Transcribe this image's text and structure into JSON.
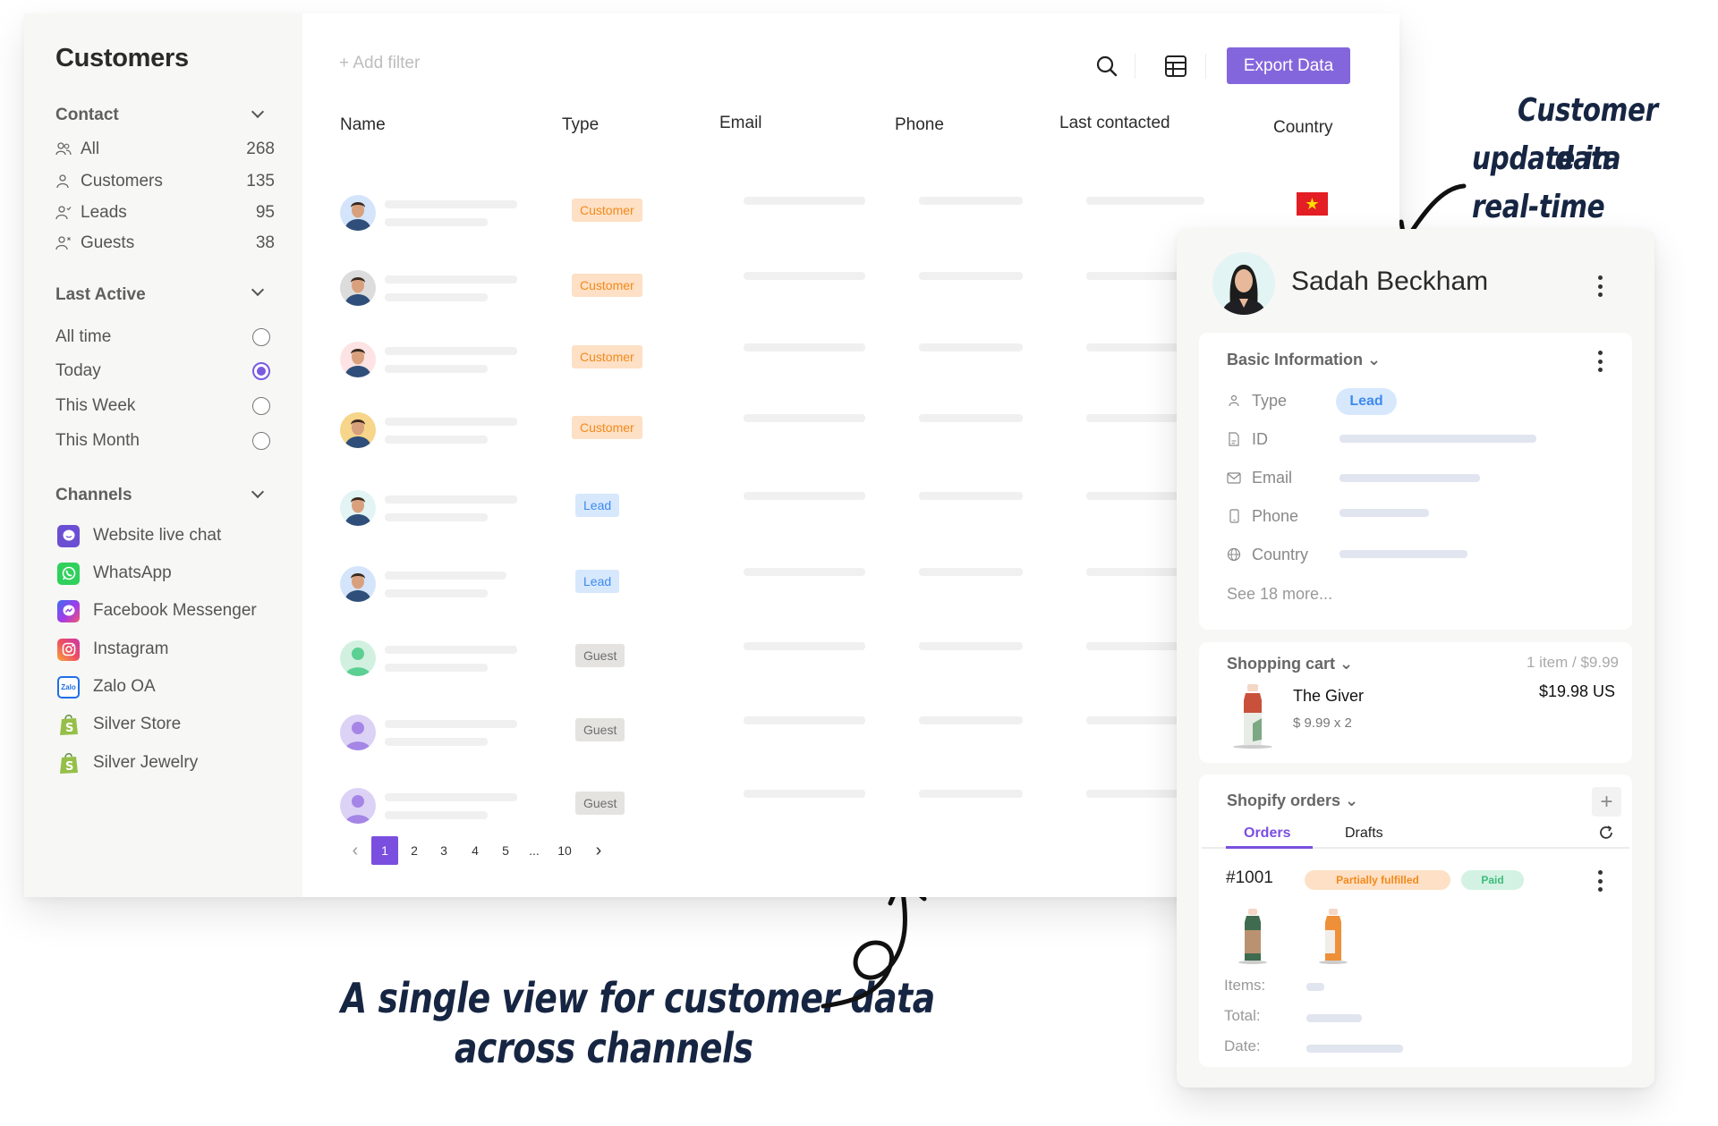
{
  "sidebar": {
    "title": "Customers",
    "contact": {
      "heading": "Contact",
      "items": [
        {
          "label": "All",
          "count": "268",
          "icon": "users-icon"
        },
        {
          "label": "Customers",
          "count": "135",
          "icon": "user-icon"
        },
        {
          "label": "Leads",
          "count": "95",
          "icon": "user-check-icon"
        },
        {
          "label": "Guests",
          "count": "38",
          "icon": "user-x-icon"
        }
      ]
    },
    "last_active": {
      "heading": "Last Active",
      "options": [
        {
          "label": "All time",
          "selected": false
        },
        {
          "label": "Today",
          "selected": true
        },
        {
          "label": "This Week",
          "selected": false
        },
        {
          "label": "This Month",
          "selected": false
        }
      ]
    },
    "channels": {
      "heading": "Channels",
      "items": [
        {
          "label": "Website live chat",
          "icon": "live-chat-icon",
          "color": "#6a4fd3"
        },
        {
          "label": "WhatsApp",
          "icon": "whatsapp-icon",
          "color": "#2fd05c"
        },
        {
          "label": "Facebook Messenger",
          "icon": "messenger-icon",
          "color": "#a33be8"
        },
        {
          "label": "Instagram",
          "icon": "instagram-icon",
          "color": "#ee4f62"
        },
        {
          "label": "Zalo OA",
          "icon": "zalo-icon",
          "color": "#1f6ee8"
        },
        {
          "label": "Silver Store",
          "icon": "shopify-icon",
          "color": "#8bb93f"
        },
        {
          "label": "Silver Jewelry",
          "icon": "shopify-icon",
          "color": "#8bb93f"
        }
      ]
    }
  },
  "toolbar": {
    "add_filter": "+ Add filter",
    "export_label": "Export Data",
    "accent": "#8466dc"
  },
  "table": {
    "columns": [
      "Name",
      "Type",
      "Email",
      "Phone",
      "Last contacted",
      "Country"
    ],
    "rows": [
      {
        "type": "Customer",
        "avatar": "photo",
        "avatar_bg": "#d4e4fb",
        "country": "Vietnam"
      },
      {
        "type": "Customer",
        "avatar": "photo",
        "avatar_bg": "#dcdcdc"
      },
      {
        "type": "Customer",
        "avatar": "photo",
        "avatar_bg": "#fde3e3"
      },
      {
        "type": "Customer",
        "avatar": "photo",
        "avatar_bg": "#f7d58a"
      },
      {
        "type": "Lead",
        "avatar": "photo",
        "avatar_bg": "#e2f4f3"
      },
      {
        "type": "Lead",
        "avatar": "photo",
        "avatar_bg": "#d4e4fb"
      },
      {
        "type": "Guest",
        "avatar": "placeholder",
        "avatar_bg": "#d2f0e0",
        "avatar_fg": "#5ccf93"
      },
      {
        "type": "Guest",
        "avatar": "placeholder",
        "avatar_bg": "#dcd2f5",
        "avatar_fg": "#a585e6"
      },
      {
        "type": "Guest",
        "avatar": "placeholder",
        "avatar_bg": "#dcd2f5",
        "avatar_fg": "#a585e6"
      }
    ]
  },
  "pagination": {
    "pages": [
      "1",
      "2",
      "3",
      "4",
      "5",
      "...",
      "10"
    ],
    "current": "1",
    "prev": "‹",
    "next": "›"
  },
  "detail": {
    "name": "Sadah Beckham",
    "basic_info": {
      "title": "Basic Information ⌄",
      "fields": [
        {
          "label": "Type",
          "icon": "user-icon",
          "value": "Lead"
        },
        {
          "label": "ID",
          "icon": "document-icon"
        },
        {
          "label": "Email",
          "icon": "mail-icon"
        },
        {
          "label": "Phone",
          "icon": "phone-icon"
        },
        {
          "label": "Country",
          "icon": "globe-icon"
        }
      ],
      "see_more": "See 18 more..."
    },
    "cart": {
      "title": "Shopping cart ⌄",
      "summary": "1 item /  $9.99",
      "item_name": "The Giver",
      "item_qty": "$ 9.99 x 2",
      "item_total": "$19.98 US"
    },
    "orders": {
      "title": "Shopify orders ⌄",
      "tabs": [
        "Orders",
        "Drafts"
      ],
      "active_tab": "Orders",
      "order_id": "#1001",
      "fulfillment": "Partially fulfilled",
      "payment": "Paid",
      "labels": {
        "items": "Items:",
        "total": "Total:",
        "date": "Date:"
      }
    }
  },
  "annotations": {
    "top_right": [
      "Customer data",
      "update in real-time"
    ],
    "bottom": [
      "A single view for customer data",
      "across channels"
    ]
  }
}
